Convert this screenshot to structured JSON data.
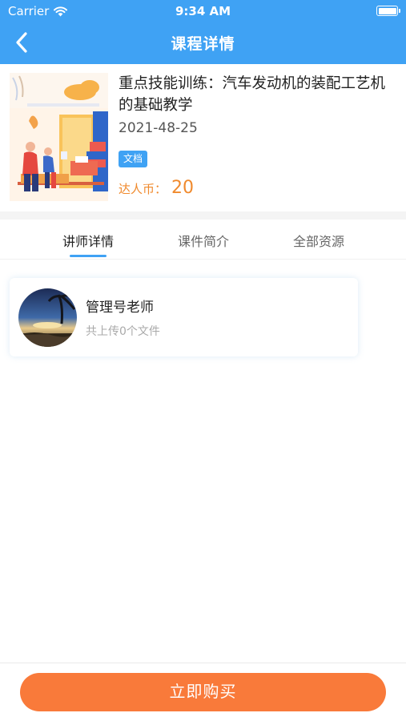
{
  "status_bar": {
    "carrier": "Carrier",
    "time": "9:34 AM"
  },
  "nav": {
    "title": "课程详情"
  },
  "course": {
    "title": "重点技能训练：汽车发动机的装配工艺机的基础教学",
    "date": "2021-48-25",
    "badge": "文档",
    "coin_label": "达人币：",
    "coin_value": "20"
  },
  "tabs": [
    {
      "label": "讲师详情"
    },
    {
      "label": "课件简介"
    },
    {
      "label": "全部资源"
    }
  ],
  "teacher": {
    "name": "管理号老师",
    "files": "共上传0个文件"
  },
  "buy_button": {
    "label": "立即购买"
  },
  "colors": {
    "primary": "#3fa2f4",
    "accent": "#f97a3a",
    "coin": "#f08a2d"
  }
}
